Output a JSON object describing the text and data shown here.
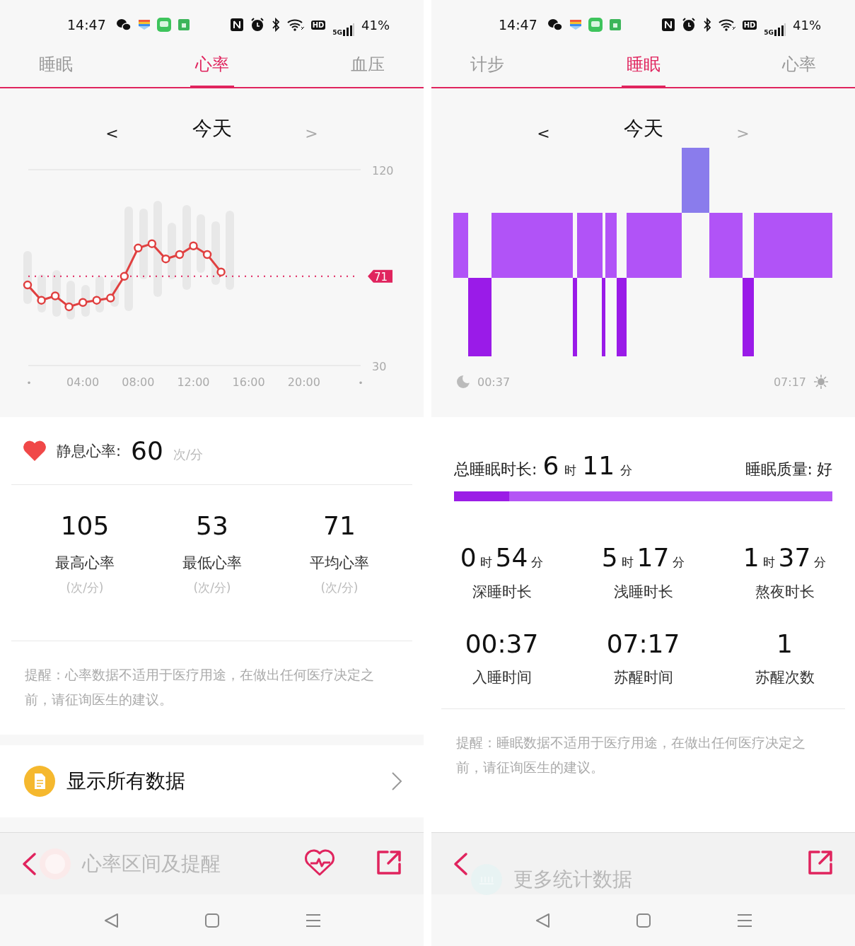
{
  "panels": [
    {
      "kind": "heart_rate",
      "status_bar": {
        "time": "14:47",
        "hd": "HD",
        "network": "5G",
        "battery": "41%"
      },
      "tabs": [
        {
          "label": "睡眠",
          "selected": false
        },
        {
          "label": "心率",
          "selected": true
        },
        {
          "label": "血压",
          "selected": false
        }
      ],
      "date_nav": {
        "prev": "<",
        "label": "今天",
        "next": ">"
      },
      "chart_data": {
        "type": "line",
        "x": [
          0,
          1,
          2,
          3,
          4,
          5,
          6,
          7,
          8,
          9,
          10,
          11,
          12,
          13,
          14
        ],
        "series": [
          {
            "color": "#e04040",
            "marker": "o",
            "values": [
              67,
              60,
              62,
              57,
              59,
              60,
              61,
              71,
              84,
              86,
              79,
              81,
              85,
              81,
              73
            ]
          }
        ],
        "xlim": [
          0,
          24
        ],
        "ylim": [
          30,
          120
        ],
        "xticks": [
          {
            "value": 0,
            "label": "•"
          },
          {
            "value": 4,
            "label": "04:00"
          },
          {
            "value": 8,
            "label": "08:00"
          },
          {
            "value": 12,
            "label": "12:00"
          },
          {
            "value": 16,
            "label": "16:00"
          },
          {
            "value": 20,
            "label": "20:00"
          },
          {
            "value": 24,
            "label": "•"
          }
        ],
        "yticks": [
          30,
          120
        ],
        "ref_lines": [
          {
            "axis": "y",
            "value": 71,
            "label": "71",
            "color": "#e0245e"
          }
        ]
      },
      "resting": {
        "label": "静息心率:",
        "value": "60",
        "unit": "次/分"
      },
      "stats": [
        {
          "kind": "value",
          "value": "105",
          "label": "最高心率",
          "unit": "(次/分)"
        },
        {
          "kind": "value",
          "value": "53",
          "label": "最低心率",
          "unit": "(次/分)"
        },
        {
          "kind": "value",
          "value": "71",
          "label": "平均心率",
          "unit": "(次/分)"
        }
      ],
      "note": "提醒：心率数据不适用于医疗用途，在做出任何医疗决定之前，请征询医生的建议。",
      "link": {
        "label": "显示所有数据"
      },
      "bottom_bar": {
        "title_icon": {
          "kind": "heart"
        },
        "faded_title": "心率区间及提醒",
        "actions": [
          {
            "kind": "heart_rate"
          },
          {
            "kind": "share"
          }
        ]
      }
    },
    {
      "kind": "sleep",
      "status_bar": {
        "time": "14:47",
        "hd": "HD",
        "network": "5G",
        "battery": "41%"
      },
      "tabs": [
        {
          "label": "计步",
          "selected": false
        },
        {
          "label": "睡眠",
          "selected": true
        },
        {
          "label": "心率",
          "selected": false
        }
      ],
      "date_nav": {
        "prev": "<",
        "label": "今天",
        "next": ">"
      },
      "sleep_chart": {
        "start": "00:37",
        "end": "07:17"
      },
      "summary": {
        "label": "总睡眠时长:",
        "hours": "6",
        "hours_unit": "时",
        "minutes": "11",
        "minutes_unit": "分",
        "quality_label": "睡眠质量:",
        "quality": "好"
      },
      "deep_share": {
        "level": 0.145
      },
      "stats": [
        {
          "kind": "duration",
          "hours": "0",
          "hours_unit": "时",
          "minutes": "54",
          "minutes_unit": "分",
          "label": "深睡时长"
        },
        {
          "kind": "duration",
          "hours": "5",
          "hours_unit": "时",
          "minutes": "17",
          "minutes_unit": "分",
          "label": "浅睡时长"
        },
        {
          "kind": "duration",
          "hours": "1",
          "hours_unit": "时",
          "minutes": "37",
          "minutes_unit": "分",
          "label": "熬夜时长"
        },
        {
          "kind": "value",
          "value": "00:37",
          "label": "入睡时间"
        },
        {
          "kind": "value",
          "value": "07:17",
          "label": "苏醒时间"
        },
        {
          "kind": "value",
          "value": "1",
          "label": "苏醒次数"
        }
      ],
      "note": "提醒：睡眠数据不适用于医疗用途，在做出任何医疗决定之前，请征询医生的建议。",
      "bottom_bar": {
        "title_icon": {
          "kind": "chart"
        },
        "faded_title": "更多统计数据",
        "actions": [
          {
            "kind": "share"
          }
        ]
      }
    }
  ]
}
